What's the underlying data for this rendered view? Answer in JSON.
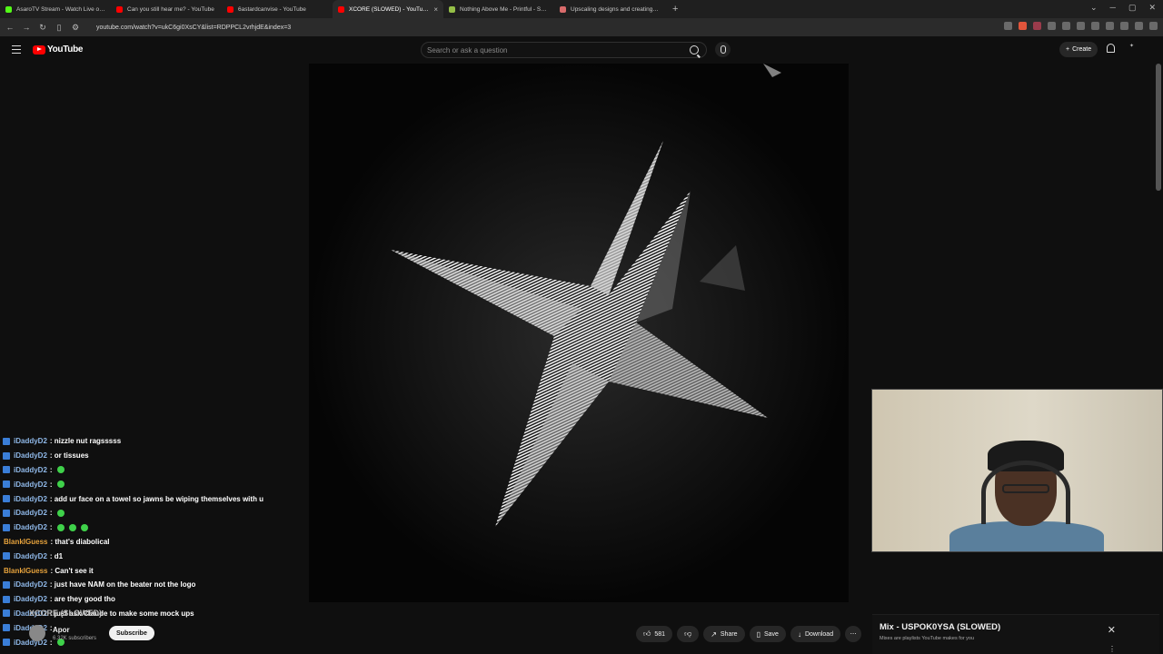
{
  "browser": {
    "tabs": [
      {
        "title": "AsaroTV Stream - Watch Live on Kick",
        "color": "#53fc18",
        "active": false
      },
      {
        "title": "Can you still hear me? - YouTube",
        "color": "#ff0000",
        "active": false
      },
      {
        "title": "6astardcanvise - YouTube",
        "color": "#ff0000",
        "active": false
      },
      {
        "title": "XCORE (SLOWED) - YouTube",
        "color": "#ff0000",
        "active": true
      },
      {
        "title": "Nothing Above Me - Printful - Shopify",
        "color": "#95bf47",
        "active": false
      },
      {
        "title": "Upscaling designs and creating Y2K",
        "color": "#d96b6b",
        "active": false
      }
    ],
    "url": "youtube.com/watch?v=ukC6gi0XsCY&list=RDPPCL2vrhjdE&index=3"
  },
  "header": {
    "logo_text": "YouTube",
    "search_placeholder": "Search or ask a question",
    "create_label": "Create"
  },
  "chat": {
    "lines": [
      {
        "user": "iDaddyD2",
        "msg": ": nizzle nut ragsssss",
        "emotes": 0,
        "orange": false
      },
      {
        "user": "iDaddyD2",
        "msg": ": or tissues",
        "emotes": 0,
        "orange": false
      },
      {
        "user": "iDaddyD2",
        "msg": ":",
        "emotes": 1,
        "orange": false
      },
      {
        "user": "iDaddyD2",
        "msg": ":",
        "emotes": 1,
        "orange": false
      },
      {
        "user": "iDaddyD2",
        "msg": ": add ur face on a towel so jawns be wiping themselves with u",
        "emotes": 0,
        "orange": false
      },
      {
        "user": "iDaddyD2",
        "msg": ":",
        "emotes": 1,
        "orange": false
      },
      {
        "user": "iDaddyD2",
        "msg": ":",
        "emotes": 3,
        "orange": false
      },
      {
        "user": "BlankIGuess",
        "msg": ": that's diabolical",
        "emotes": 0,
        "orange": true
      },
      {
        "user": "iDaddyD2",
        "msg": ": d1",
        "emotes": 0,
        "orange": false
      },
      {
        "user": "BlankIGuess",
        "msg": ": Can't see it",
        "emotes": 0,
        "orange": true
      },
      {
        "user": "iDaddyD2",
        "msg": ": just have NAM on the beater not the logo",
        "emotes": 0,
        "orange": false
      },
      {
        "user": "iDaddyD2",
        "msg": ": are they good tho",
        "emotes": 0,
        "orange": false
      },
      {
        "user": "iDaddyD2",
        "msg": ": just ask Claude to make some mock ups",
        "emotes": 0,
        "orange": false
      },
      {
        "user": "iDaddyD2",
        "msg": ":",
        "emotes": 0,
        "orange": false
      },
      {
        "user": "iDaddyD2",
        "msg": ":",
        "emotes": 1,
        "orange": false
      }
    ]
  },
  "video": {
    "title": "XCORE (SLOWED)",
    "channel": "Apor",
    "subscribers": "6.32K subscribers",
    "subscribe_label": "Subscribe",
    "likes": "581",
    "share_label": "Share",
    "save_label": "Save",
    "download_label": "Download"
  },
  "mix": {
    "title": "Mix - USPOK0YSA (SLOWED)",
    "subtitle": "Mixes are playlists YouTube makes for you"
  }
}
